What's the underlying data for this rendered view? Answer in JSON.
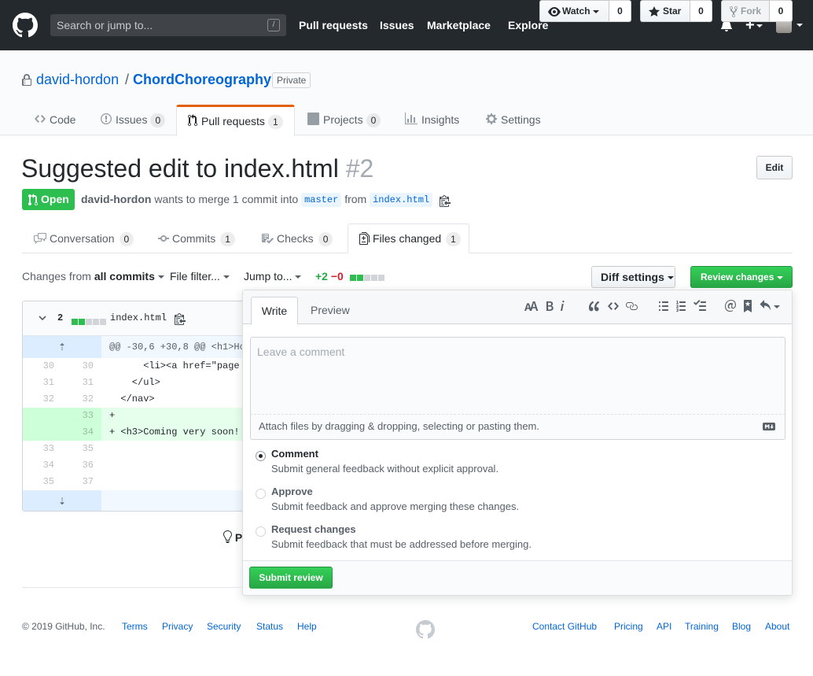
{
  "header": {
    "search_placeholder": "Search or jump to...",
    "search_shortcut": "/",
    "nav": [
      "Pull requests",
      "Issues",
      "Marketplace",
      "Explore"
    ],
    "plus": "+"
  },
  "repo": {
    "owner": "david-hordon",
    "separator": "/",
    "name": "ChordChoreography",
    "visibility": "Private",
    "watch_label": "Watch",
    "watch_count": "0",
    "star_label": "Star",
    "star_count": "0",
    "fork_label": "Fork",
    "fork_count": "0",
    "tabs": [
      {
        "label": "Code",
        "count": ""
      },
      {
        "label": "Issues",
        "count": "0"
      },
      {
        "label": "Pull requests",
        "count": "1"
      },
      {
        "label": "Projects",
        "count": "0"
      },
      {
        "label": "Insights",
        "count": ""
      },
      {
        "label": "Settings",
        "count": ""
      }
    ]
  },
  "pr": {
    "title": "Suggested edit to index.html",
    "number": "#2",
    "edit_label": "Edit",
    "state": "Open",
    "author": "david-hordon",
    "meta_text": "wants to merge 1 commit into",
    "base_branch": "master",
    "from_text": "from",
    "head_branch": "index.html",
    "tabs": [
      {
        "label": "Conversation",
        "count": "0"
      },
      {
        "label": "Commits",
        "count": "1"
      },
      {
        "label": "Checks",
        "count": "0"
      },
      {
        "label": "Files changed",
        "count": "1"
      }
    ]
  },
  "toolbar": {
    "changes_from_label": "Changes from",
    "changes_from_value": "all commits",
    "file_filter": "File filter...",
    "jump_to": "Jump to...",
    "additions": "+2",
    "deletions": "−0",
    "diff_settings": "Diff settings",
    "review_changes": "Review changes"
  },
  "diff": {
    "changes": "2",
    "filename": "index.html",
    "hunk_header": "@@ -30,6 +30,8 @@ <h1>Ho",
    "lines": [
      {
        "old": "30",
        "new": "30",
        "type": "ctx",
        "code": "      <li><a href=\"page"
      },
      {
        "old": "31",
        "new": "31",
        "type": "ctx",
        "code": "    </ul>"
      },
      {
        "old": "32",
        "new": "32",
        "type": "ctx",
        "code": "  </nav>"
      },
      {
        "old": "",
        "new": "33",
        "type": "add",
        "code": "+"
      },
      {
        "old": "",
        "new": "34",
        "type": "add",
        "code": "+ <h3>Coming very soon!"
      },
      {
        "old": "33",
        "new": "35",
        "type": "ctx",
        "code": ""
      },
      {
        "old": "34",
        "new": "36",
        "type": "ctx",
        "code": ""
      },
      {
        "old": "35",
        "new": "37",
        "type": "ctx",
        "code": ""
      }
    ]
  },
  "tip_text": "P",
  "review": {
    "write_tab": "Write",
    "preview_tab": "Preview",
    "comment_placeholder": "Leave a comment",
    "attach_text": "Attach files by dragging & dropping, selecting or pasting them.",
    "options": [
      {
        "title": "Comment",
        "desc": "Submit general feedback without explicit approval.",
        "selected": true
      },
      {
        "title": "Approve",
        "desc": "Submit feedback and approve merging these changes.",
        "selected": false
      },
      {
        "title": "Request changes",
        "desc": "Submit feedback that must be addressed before merging.",
        "selected": false
      }
    ],
    "submit_label": "Submit review"
  },
  "footer": {
    "copyright": "© 2019 GitHub, Inc.",
    "left_links": [
      "Terms",
      "Privacy",
      "Security",
      "Status",
      "Help"
    ],
    "right_links": [
      "Contact GitHub",
      "Pricing",
      "API",
      "Training",
      "Blog",
      "About"
    ]
  },
  "colors": {
    "header_bg": "#24292e",
    "link": "#0366d6",
    "open_green": "#2cbe4e",
    "active_tab": "#e36209"
  }
}
